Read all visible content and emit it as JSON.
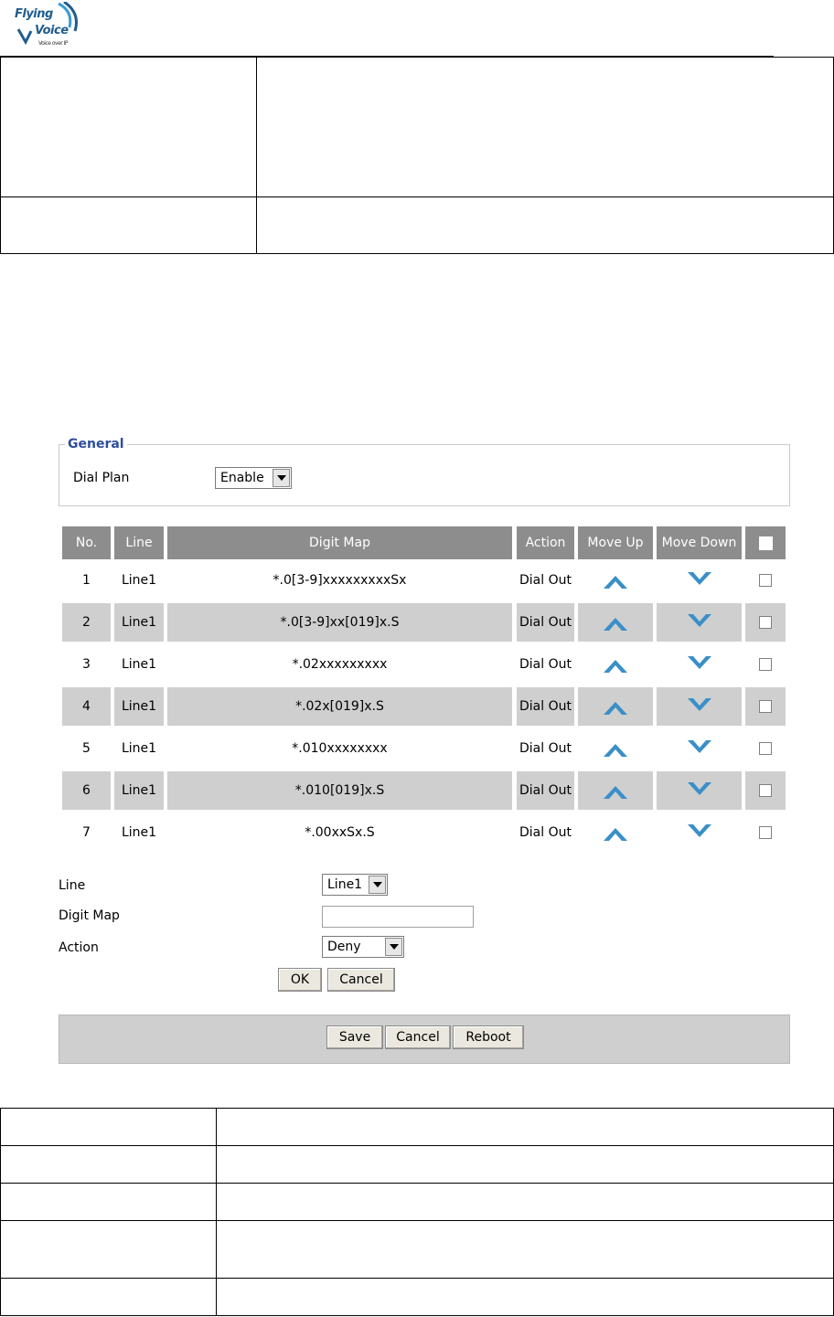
{
  "brand": {
    "line1": "Flying",
    "line2": "Voice",
    "tagline": "Voice over IP"
  },
  "general": {
    "legend": "General",
    "dial_plan_label": "Dial Plan",
    "dial_plan_value": "Enable"
  },
  "table": {
    "headers": [
      "No.",
      "Line",
      "Digit Map",
      "Action",
      "Move Up",
      "Move Down"
    ],
    "rows": [
      {
        "no": "1",
        "line": "Line1",
        "digit_map": "*.0[3-9]xxxxxxxxxSx",
        "action": "Dial Out"
      },
      {
        "no": "2",
        "line": "Line1",
        "digit_map": "*.0[3-9]xx[019]x.S",
        "action": "Dial Out"
      },
      {
        "no": "3",
        "line": "Line1",
        "digit_map": "*.02xxxxxxxxx",
        "action": "Dial Out"
      },
      {
        "no": "4",
        "line": "Line1",
        "digit_map": "*.02x[019]x.S",
        "action": "Dial Out"
      },
      {
        "no": "5",
        "line": "Line1",
        "digit_map": "*.010xxxxxxxx",
        "action": "Dial Out"
      },
      {
        "no": "6",
        "line": "Line1",
        "digit_map": "*.010[019]x.S",
        "action": "Dial Out"
      },
      {
        "no": "7",
        "line": "Line1",
        "digit_map": "*.00xxSx.S",
        "action": "Dial Out"
      }
    ]
  },
  "form": {
    "line_label": "Line",
    "line_value": "Line1",
    "digit_map_label": "Digit Map",
    "digit_map_value": "",
    "action_label": "Action",
    "action_value": "Deny",
    "ok_label": "OK",
    "cancel_label": "Cancel"
  },
  "footer": {
    "save_label": "Save",
    "cancel_label": "Cancel",
    "reboot_label": "Reboot"
  },
  "colors": {
    "header_bg": "#8d8d8d",
    "alt_row_bg": "#cfcfcf",
    "legend_blue": "#2e4d9e",
    "arrow_blue": "#3a8fc8"
  }
}
